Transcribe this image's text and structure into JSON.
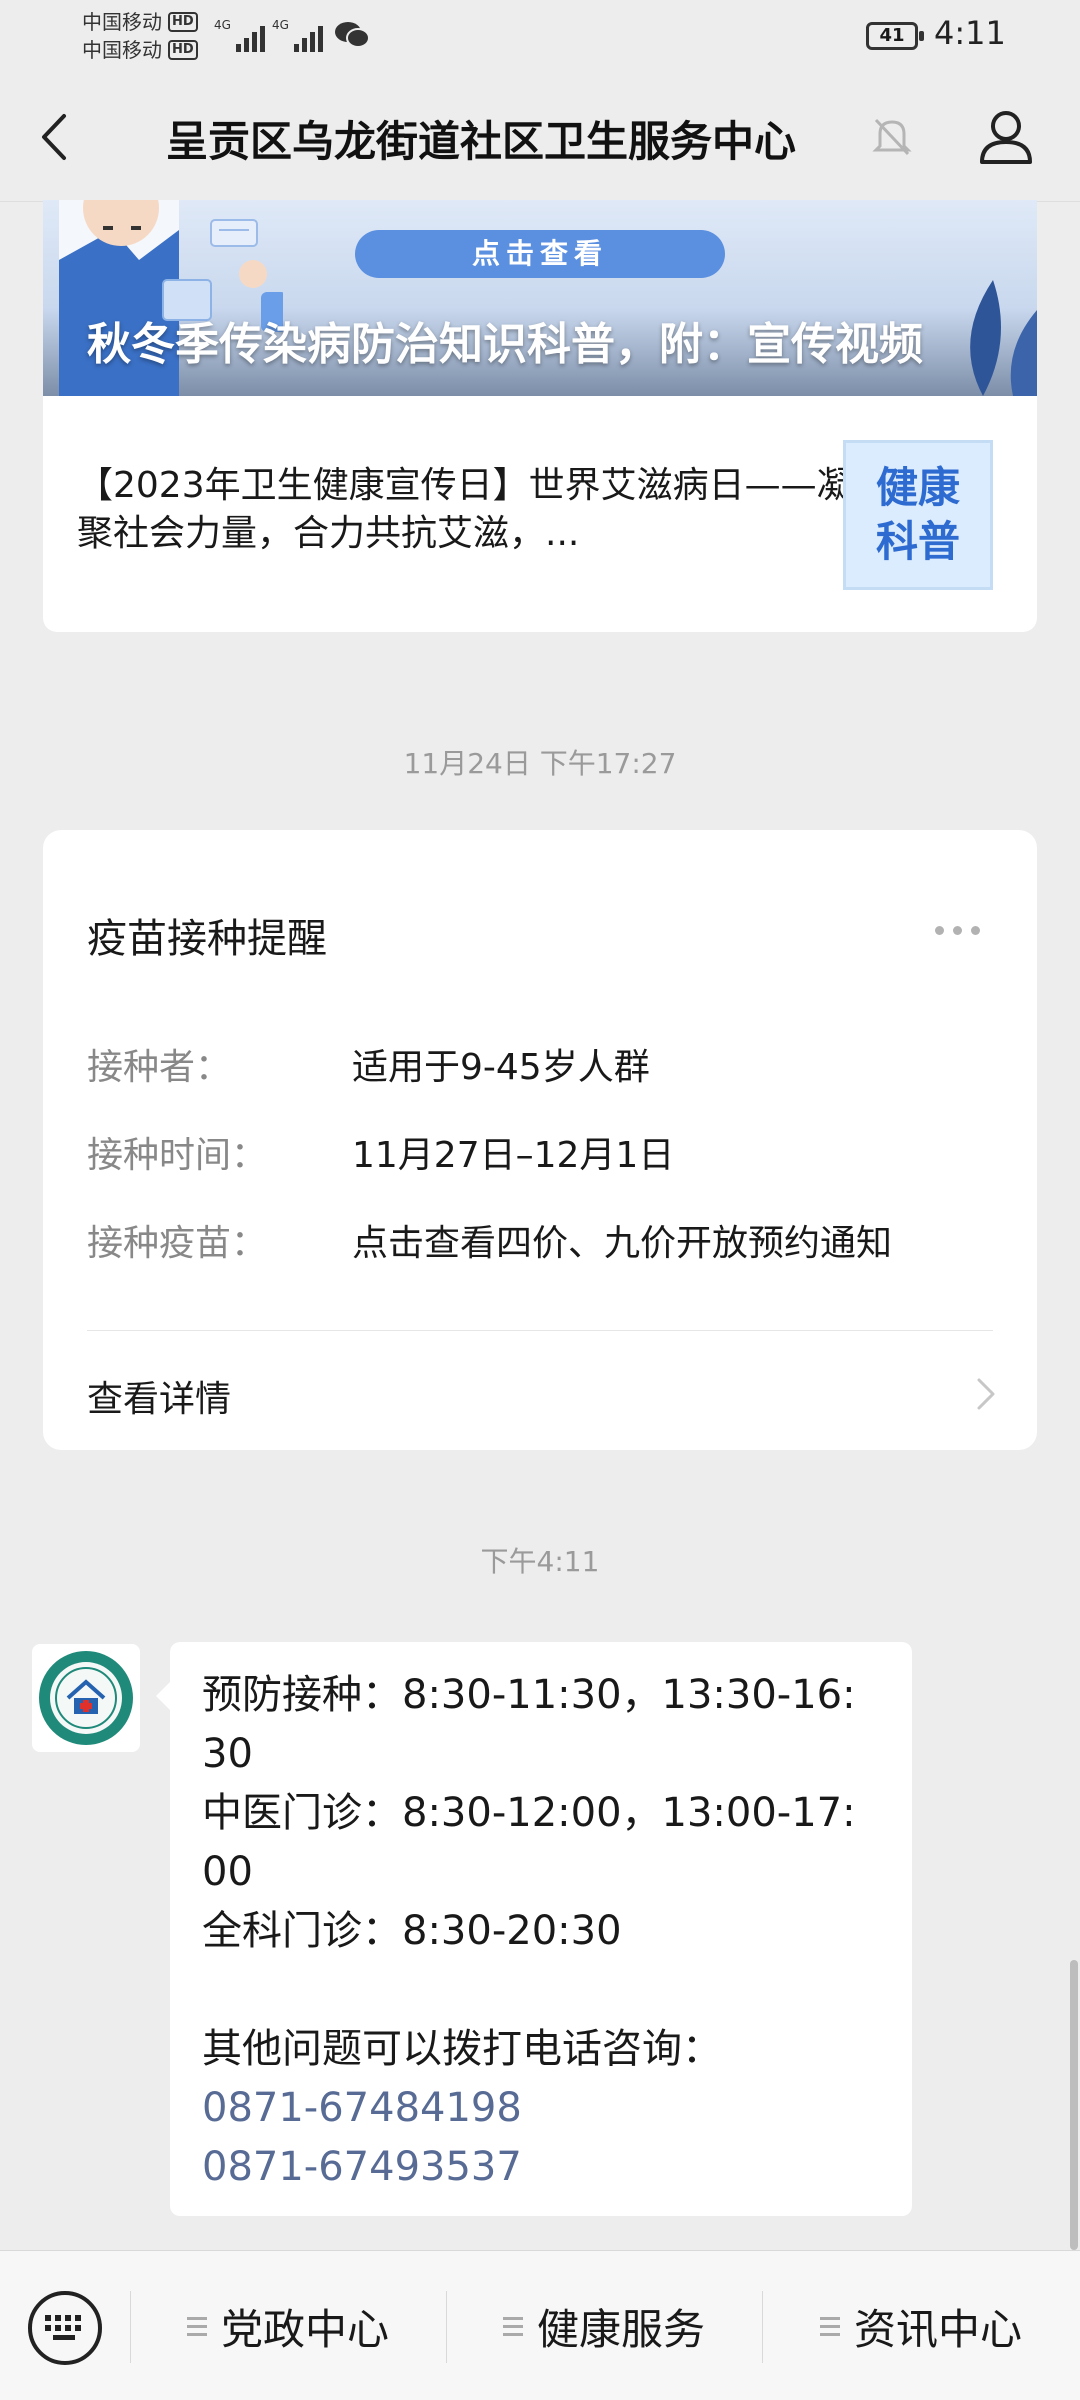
{
  "status_bar": {
    "carrier1": "中国移动",
    "carrier2": "中国移动",
    "hd": "HD",
    "network1": "4G",
    "network2": "4G",
    "battery": "41",
    "time": "4:11"
  },
  "nav": {
    "title": "呈贡区乌龙街道社区卫生服务中心",
    "icons": [
      "back-arrow-icon",
      "mute-bell-icon",
      "profile-icon"
    ]
  },
  "article": {
    "banner_button": "点击查看",
    "banner_title": "秋冬季传染病防治知识科普，附：宣传视频",
    "sub_title": "【2023年卫生健康宣传日】世界艾滋病日——凝聚社会力量，合力共抗艾滋，...",
    "thumb_line1": "健康",
    "thumb_line2": "科普"
  },
  "timestamp1": "11月24日 下午17:27",
  "template_card": {
    "title": "疫苗接种提醒",
    "rows": [
      {
        "key": "接种者：",
        "value": "适用于9-45岁人群"
      },
      {
        "key": "接种时间：",
        "value": "11月27日–12月1日"
      },
      {
        "key": "接种疫苗：",
        "value": "点击查看四价、九价开放预约通知"
      }
    ],
    "detail": "查看详情"
  },
  "timestamp2": "下午4:11",
  "message": {
    "line1": "预防接种：8:30-11:30，13:30-16:30",
    "line2": "中医门诊：8:30-12:00，13:00-17:00",
    "line3": "全科门诊：8:30-20:30",
    "line4": "其他问题可以拨打电话咨询：",
    "phone1": "0871-67484198",
    "phone2": "0871-67493537"
  },
  "bottom_menu": {
    "items": [
      "党政中心",
      "健康服务",
      "资讯中心"
    ]
  },
  "colors": {
    "background": "#ededed",
    "link": "#576b95",
    "banner_button": "#5b8fe0"
  }
}
